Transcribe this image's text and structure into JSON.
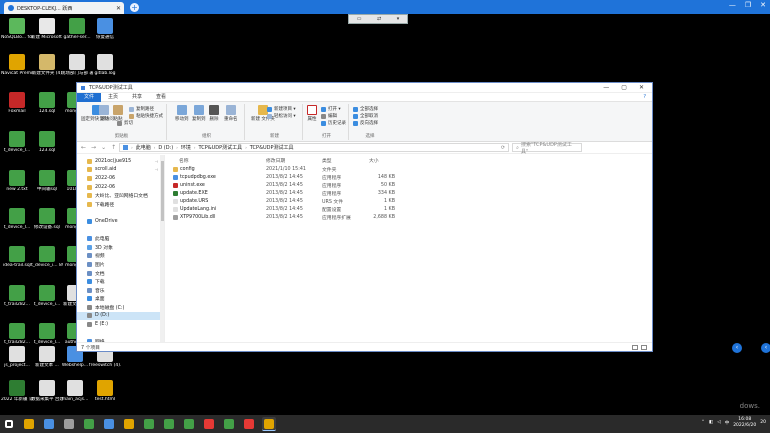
{
  "browser": {
    "tab_title": "DESKTOP-CLEKJ... 跃西",
    "new_tab": "+",
    "controls": [
      "—",
      "❐",
      "✕"
    ]
  },
  "remote_toolbar": [
    "▭",
    "⇄",
    "▾"
  ],
  "desktop_icons": [
    {
      "label": "NoSQLBo... for Mong...",
      "color": "#5cb85c"
    },
    {
      "label": "新建 Microsoft ...",
      "color": "#e8e8e8"
    },
    {
      "label": "gather-ser...",
      "color": "#43a047"
    },
    {
      "label": "恢复通信",
      "color": "#4a90e2"
    },
    {
      "label": "Navicat Premium",
      "color": "#e0a400"
    },
    {
      "label": "新建文件夹 (4)",
      "color": "#d4b86a"
    },
    {
      "label": "现场部门与部 署邮件",
      "color": "#e0e0e0"
    },
    {
      "label": "gitlab.log",
      "color": "#e0e0e0"
    },
    {
      "label": "Foxmail",
      "color": "#c62828"
    },
    {
      "label": "124.sql",
      "color": "#43a047"
    },
    {
      "label": "mongo...",
      "color": "#43a047"
    },
    {
      "label": "t_device_l...",
      "color": "#43a047"
    },
    {
      "label": "123.sql",
      "color": "#43a047"
    },
    {
      "label": "new 2.txt",
      "color": "#43a047"
    },
    {
      "label": "中间输sql",
      "color": "#43a047"
    },
    {
      "label": "101ld...",
      "color": "#43a047"
    },
    {
      "label": "t_device_l...",
      "color": "#43a047"
    },
    {
      "label": "修改设备.sql",
      "color": "#43a047"
    },
    {
      "label": "mongo...",
      "color": "#43a047"
    },
    {
      "label": "idea-trail.sql",
      "color": "#43a047"
    },
    {
      "label": "t_device_i... 893.sql",
      "color": "#43a047"
    },
    {
      "label": "mongo...",
      "color": "#43a047"
    },
    {
      "label": "t_trail282...",
      "color": "#43a047"
    },
    {
      "label": "t_device_i...",
      "color": "#43a047"
    },
    {
      "label": "新建文本 ...",
      "color": "#e0e0e0"
    },
    {
      "label": "t_trail282...",
      "color": "#43a047"
    },
    {
      "label": "t_device_l...",
      "color": "#43a047"
    },
    {
      "label": "authori...",
      "color": "#43a047"
    },
    {
      "label": "js_project...",
      "color": "#e0e0e0"
    },
    {
      "label": "新建文本 ...",
      "color": "#e0e0e0"
    },
    {
      "label": "Webshelp...",
      "color": "#4a90e2"
    },
    {
      "label": "freeswitch (4).log",
      "color": "#e0e0e0"
    },
    {
      "label": "2022 年新疆 公平标杆...",
      "color": "#2e7d32"
    },
    {
      "label": "数据采集平 台建立文",
      "color": "#e0e0e0"
    },
    {
      "label": "main_acjs...",
      "color": "#e0e0e0"
    },
    {
      "label": "test.html",
      "color": "#e0a400"
    }
  ],
  "explorer": {
    "title": "TCP&UDP测试工具",
    "window_controls": [
      "—",
      "▢",
      "✕"
    ],
    "menu": {
      "file": "文件",
      "home": "主页",
      "share": "共享",
      "view": "查看",
      "help": "?"
    },
    "ribbon": {
      "pin": "固定到快 速访问",
      "copy": "复制",
      "paste": "粘贴",
      "copy_path": "复制路径",
      "paste_shortcut": "粘贴快捷方式",
      "cut": "剪切",
      "clipboard_group": "剪贴板",
      "move_to": "移动到",
      "copy_to": "复制到",
      "delete": "删除",
      "rename": "重命名",
      "organize_group": "组织",
      "new_folder": "新建 文件夹",
      "new_item": "新建项目 ▾",
      "easy_access": "轻松访问 ▾",
      "new_group": "新建",
      "properties": "属性",
      "open": "打开 ▾",
      "edit": "编辑",
      "history": "历史记录",
      "open_group": "打开",
      "select_all": "全部选择",
      "select_none": "全部取消",
      "invert": "反向选择",
      "select_group": "选择"
    },
    "address": {
      "segments": [
        "此电脑",
        "D (D:)",
        "环境",
        "TCP&UDP测试工具",
        "TCP&UDP测试工具"
      ],
      "search_placeholder": "搜索\"TCP&UDP测试工具\""
    },
    "nav_items": [
      {
        "label": "2021oc(jue915",
        "color": "#e6b84d",
        "pin": true
      },
      {
        "label": "scroll.aid",
        "color": "#e6b84d",
        "pin": true
      },
      {
        "label": "2022-06",
        "color": "#e6b84d",
        "pin": false
      },
      {
        "label": "2022-06",
        "color": "#e6b84d",
        "pin": false
      },
      {
        "label": "大岭比、亚凹网络口文档",
        "color": "#e6b84d",
        "pin": false
      },
      {
        "label": "下载路径",
        "color": "#e6b84d",
        "pin": false
      },
      {
        "label": "",
        "color": "transparent",
        "pin": false
      },
      {
        "label": "OneDrive",
        "color": "#3b8de0",
        "pin": false
      },
      {
        "label": "",
        "color": "transparent",
        "pin": false
      },
      {
        "label": "此电脑",
        "color": "#4a90e2",
        "pin": false
      },
      {
        "label": "3D 对象",
        "color": "#5aa0e6",
        "pin": false
      },
      {
        "label": "视频",
        "color": "#6b8fc4",
        "pin": false
      },
      {
        "label": "图片",
        "color": "#6b8fc4",
        "pin": false
      },
      {
        "label": "文档",
        "color": "#6b8fc4",
        "pin": false
      },
      {
        "label": "下载",
        "color": "#3b8de0",
        "pin": false
      },
      {
        "label": "音乐",
        "color": "#6b8fc4",
        "pin": false
      },
      {
        "label": "桌面",
        "color": "#3b8de0",
        "pin": false
      },
      {
        "label": "本地磁盘 (C:)",
        "color": "#888",
        "pin": false
      },
      {
        "label": "D (D:)",
        "color": "#888",
        "pin": false,
        "selected": true
      },
      {
        "label": "E (E:)",
        "color": "#888",
        "pin": false
      },
      {
        "label": "",
        "color": "transparent",
        "pin": false
      },
      {
        "label": "网络",
        "color": "#4a90e2",
        "pin": false
      }
    ],
    "columns": {
      "name": "名称",
      "date": "修改日期",
      "type": "类型",
      "size": "大小"
    },
    "files": [
      {
        "name": "config",
        "date": "2021/1/10 15:41",
        "type": "文件夹",
        "size": "",
        "color": "#e6b84d"
      },
      {
        "name": "tcpudpdbg.exe",
        "date": "2013/8/2 14:45",
        "type": "应用程序",
        "size": "148 KB",
        "color": "#4a90e2"
      },
      {
        "name": "uninst.exe",
        "date": "2013/8/2 14:45",
        "type": "应用程序",
        "size": "50 KB",
        "color": "#c62828"
      },
      {
        "name": "update.EXE",
        "date": "2013/8/2 14:45",
        "type": "应用程序",
        "size": "334 KB",
        "color": "#2e7d32"
      },
      {
        "name": "update.URS",
        "date": "2013/8/2 14:45",
        "type": "URS 文件",
        "size": "1 KB",
        "color": "#e0e0e0"
      },
      {
        "name": "UpdateLang.ini",
        "date": "2013/8/2 14:45",
        "type": "配置设置",
        "size": "1 KB",
        "color": "#e0e0e0"
      },
      {
        "name": "XTP9700Lib.dll",
        "date": "2013/8/2 14:45",
        "type": "应用程序扩展",
        "size": "2,688 KB",
        "color": "#9e9e9e"
      }
    ],
    "status": "7 个项目"
  },
  "right_bubbles": [
    "‹",
    "‹"
  ],
  "taskbar": {
    "items": [
      {
        "name": "start",
        "color": "#ffffff"
      },
      {
        "name": "chrome",
        "color": "#e0a400"
      },
      {
        "name": "app2",
        "color": "#4a90e2"
      },
      {
        "name": "app3",
        "color": "#9e9e9e"
      },
      {
        "name": "app4",
        "color": "#43a047"
      },
      {
        "name": "app5",
        "color": "#4a90e2"
      },
      {
        "name": "app6",
        "color": "#e0a400"
      },
      {
        "name": "app7",
        "color": "#43a047"
      },
      {
        "name": "app8",
        "color": "#43a047"
      },
      {
        "name": "app9",
        "color": "#43a047"
      },
      {
        "name": "app10",
        "color": "#e53935"
      },
      {
        "name": "app11",
        "color": "#43a047"
      },
      {
        "name": "app12",
        "color": "#e53935"
      },
      {
        "name": "app13",
        "color": "#e0a400"
      }
    ],
    "time": "16:08",
    "date": "2022/6/20",
    "lang": "20"
  },
  "watermark": "dows."
}
